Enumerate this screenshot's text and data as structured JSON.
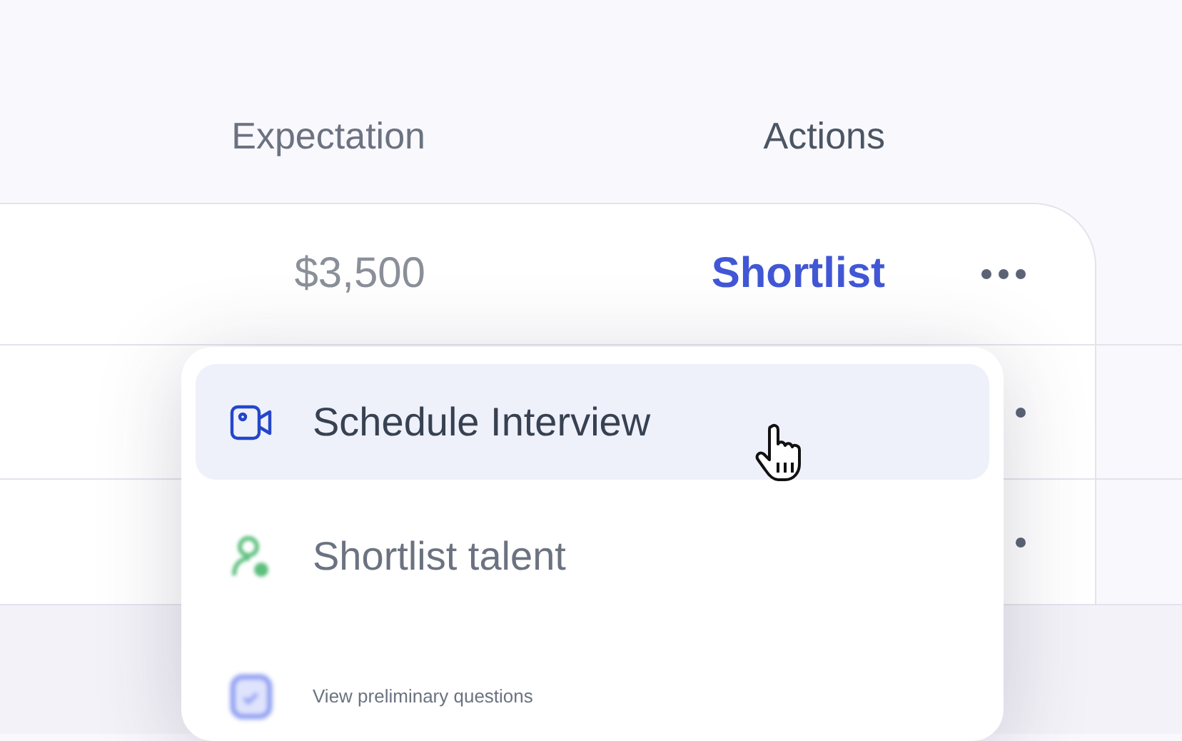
{
  "columns": [
    {
      "label": "Expectation"
    },
    {
      "label": "Actions"
    }
  ],
  "rows": [
    {
      "kind": "full",
      "expectation": "$3,500",
      "action": "Shortlist"
    },
    {
      "kind": "covered"
    },
    {
      "kind": "covered"
    }
  ],
  "menu": {
    "items": [
      {
        "kind": "video",
        "label": "Schedule Interview",
        "selected": true
      },
      {
        "kind": "person",
        "label": "Shortlist talent",
        "selected": false
      },
      {
        "kind": "calendar",
        "label": "View preliminary questions",
        "selected": false
      }
    ]
  }
}
